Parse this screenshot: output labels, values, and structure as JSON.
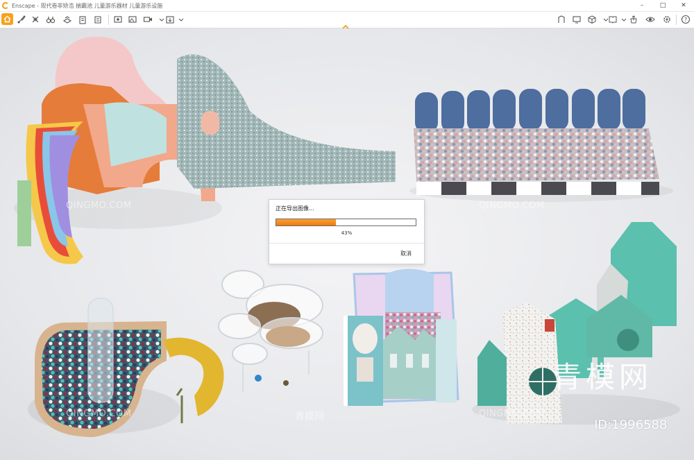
{
  "window": {
    "title": "Enscape - 现代卷非矫浩 揣霸池 儿童游乐器材 儿童游乐设施",
    "minimize": "–",
    "maximize": "□",
    "close": "✕"
  },
  "toolbar": {
    "left_icons": [
      "home-icon",
      "brush-icon",
      "settings-icon",
      "binoculars-icon",
      "bim-icon",
      "clipboard-icon",
      "screenshot-icon",
      "panorama-icon",
      "video-icon",
      "export-icon"
    ],
    "right_icons": [
      "asset-library-icon",
      "monitor-icon",
      "cube-icon",
      "book-icon",
      "upload-icon",
      "eye-icon",
      "gear-icon",
      "help-icon"
    ],
    "collapse_icon": "chevron-up-icon",
    "accent": "#f6a21d"
  },
  "dialog": {
    "title": "正在导出图像...",
    "progress": 0.43,
    "progress_text": "43%",
    "cancel_label": "取消",
    "progress_color": "#f08a1c"
  },
  "watermarks": {
    "site_text": "QINGMO.COM",
    "cn_text": "青模网",
    "logo_text": "青模网",
    "id_text": "ID:1996588"
  }
}
